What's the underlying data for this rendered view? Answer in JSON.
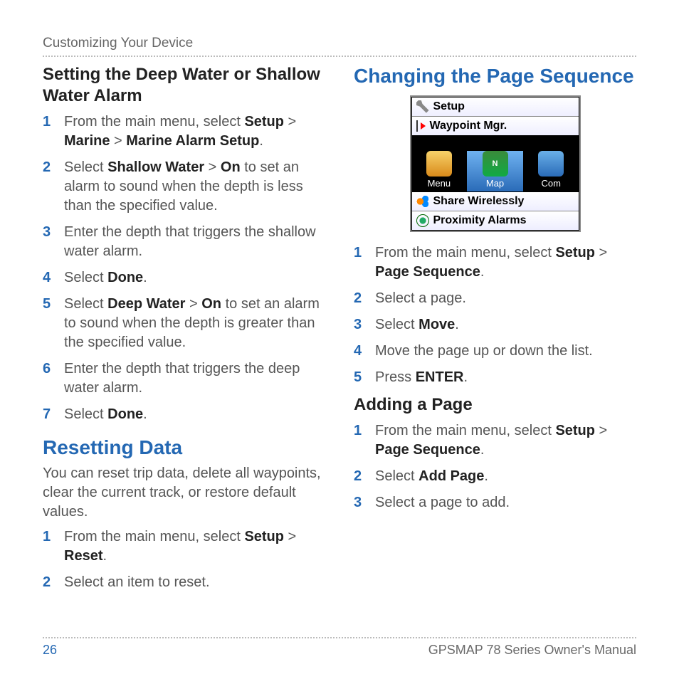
{
  "header": "Customizing Your Device",
  "footer": {
    "page": "26",
    "title": "GPSMAP 78 Series Owner's Manual"
  },
  "left": {
    "h_water": "Setting the Deep Water or Shallow Water Alarm",
    "water_steps": {
      "s1a": "From the main menu, select ",
      "s1b": "Setup",
      "s1c": " > ",
      "s1d": "Marine",
      "s1e": " > ",
      "s1f": "Marine Alarm Setup",
      "s1g": ".",
      "s2a": "Select ",
      "s2b": "Shallow Water",
      "s2c": " > ",
      "s2d": "On",
      "s2e": " to set an alarm to sound when the depth is less than the specified value.",
      "s3": "Enter the depth that triggers the shallow water alarm.",
      "s4a": "Select ",
      "s4b": "Done",
      "s4c": ".",
      "s5a": "Select ",
      "s5b": "Deep Water",
      "s5c": " > ",
      "s5d": "On",
      "s5e": " to set an alarm to sound when the depth is greater than the specified value.",
      "s6": "Enter the depth that triggers the deep water alarm.",
      "s7a": "Select ",
      "s7b": "Done",
      "s7c": "."
    },
    "h_reset": "Resetting Data",
    "reset_intro": "You can reset trip data, delete all waypoints, clear the current track, or restore default values.",
    "reset_steps": {
      "s1a": "From the main menu, select ",
      "s1b": "Setup",
      "s1c": " > ",
      "s1d": "Reset",
      "s1e": ".",
      "s2": "Select an item to reset."
    }
  },
  "right": {
    "h_seq": "Changing the Page Sequence",
    "device": {
      "setup": "Setup",
      "waypoint": "Waypoint Mgr.",
      "menu": "Menu",
      "map": "Map",
      "com": "Com",
      "share": "Share Wirelessly",
      "prox": "Proximity Alarms"
    },
    "seq_steps": {
      "s1a": "From the main menu, select ",
      "s1b": "Setup",
      "s1c": " > ",
      "s1d": "Page Sequence",
      "s1e": ".",
      "s2": "Select a page.",
      "s3a": "Select ",
      "s3b": "Move",
      "s3c": ".",
      "s4": "Move the page up or down the list.",
      "s5a": "Press ",
      "s5b": "ENTER",
      "s5c": "."
    },
    "h_add": "Adding a Page",
    "add_steps": {
      "s1a": "From the main menu, select ",
      "s1b": "Setup",
      "s1c": " > ",
      "s1d": "Page Sequence",
      "s1e": ".",
      "s2a": "Select ",
      "s2b": "Add Page",
      "s2c": ".",
      "s3": "Select a page to add."
    }
  }
}
